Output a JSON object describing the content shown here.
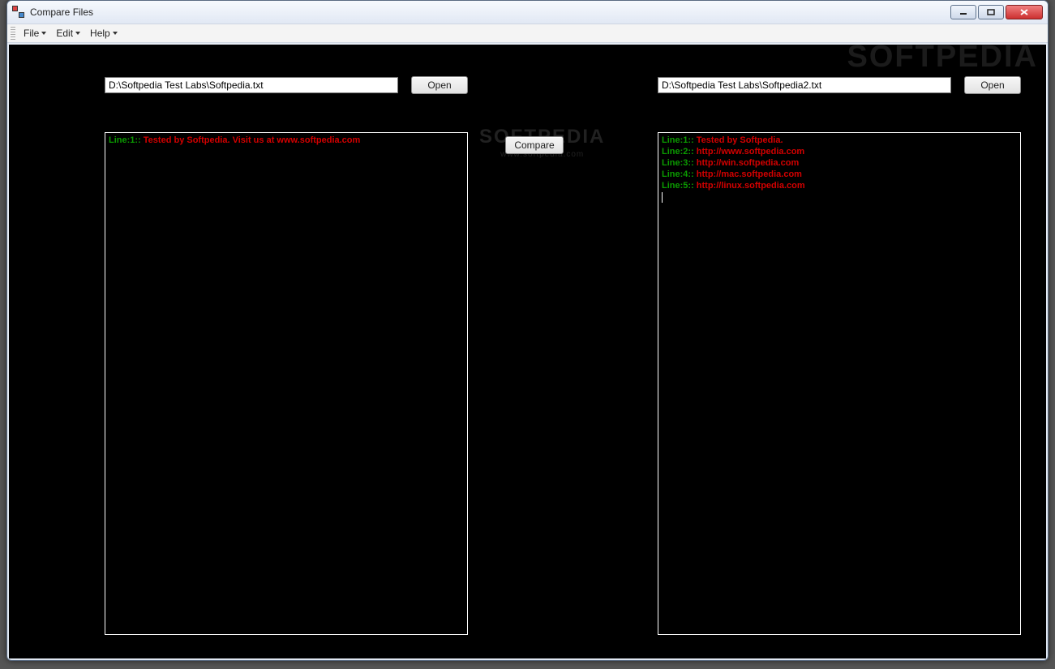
{
  "window": {
    "title": "Compare Files"
  },
  "menubar": {
    "items": [
      "File",
      "Edit",
      "Help"
    ]
  },
  "watermark": {
    "big": "SOFTPEDIA",
    "center_big": "SOFTPEDIA",
    "center_small": "www.softpedia.com"
  },
  "left": {
    "path": "D:\\Softpedia Test Labs\\Softpedia.txt",
    "open_label": "Open",
    "lines": [
      {
        "prefix": "Line:1:: ",
        "text": "Tested by Softpedia. Visit us at www.softpedia.com"
      }
    ]
  },
  "right": {
    "path": "D:\\Softpedia Test Labs\\Softpedia2.txt",
    "open_label": "Open",
    "lines": [
      {
        "prefix": "Line:1:: ",
        "text": "Tested by Softpedia."
      },
      {
        "prefix": "Line:2:: ",
        "text": "http://www.softpedia.com"
      },
      {
        "prefix": "Line:3:: ",
        "text": "http://win.softpedia.com"
      },
      {
        "prefix": "Line:4:: ",
        "text": "http://mac.softpedia.com"
      },
      {
        "prefix": "Line:5:: ",
        "text": "http://linux.softpedia.com"
      }
    ]
  },
  "compare_label": "Compare"
}
